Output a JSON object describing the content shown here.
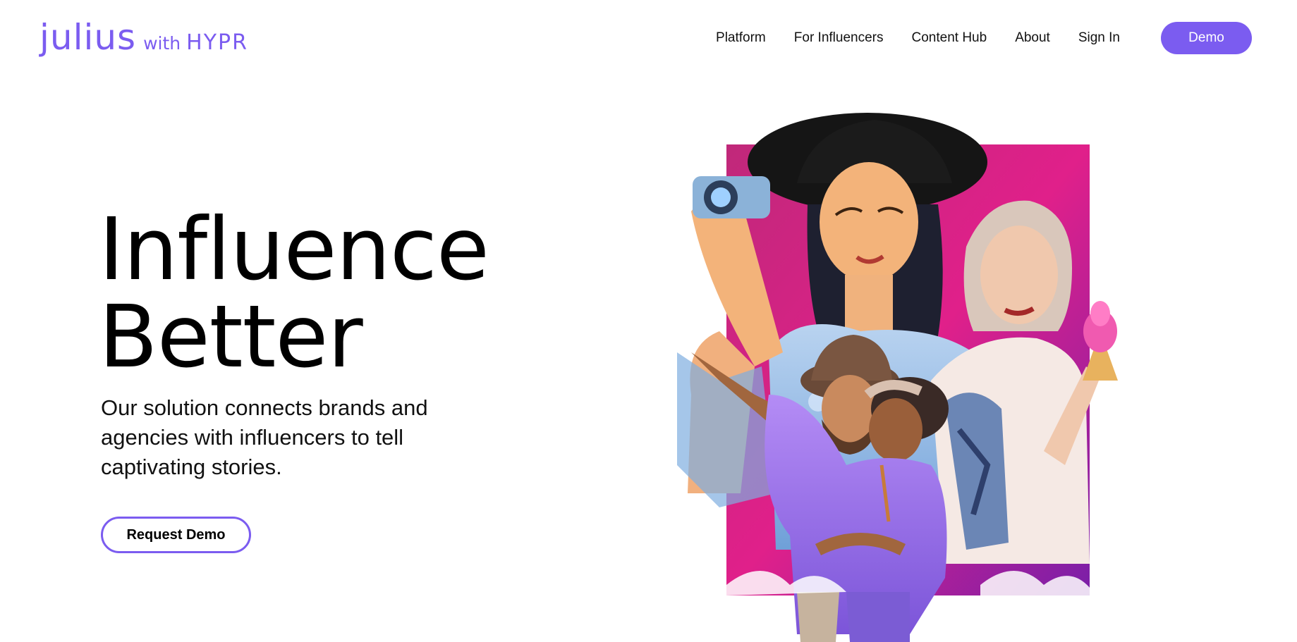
{
  "header": {
    "logo": {
      "main": "julius",
      "with": "with",
      "brand": "HYPR"
    },
    "nav": [
      {
        "label": "Platform"
      },
      {
        "label": "For Influencers"
      },
      {
        "label": "Content Hub"
      },
      {
        "label": "About"
      },
      {
        "label": "Sign In"
      }
    ],
    "demo_label": "Demo"
  },
  "hero": {
    "title_line1": "Influence",
    "title_line2": "Better",
    "subtitle": "Our solution connects brands and agencies with influencers to tell captivating stories.",
    "cta_label": "Request Demo"
  },
  "colors": {
    "accent": "#7b5cf0",
    "text": "#111111",
    "magenta": "#e0208a",
    "purple": "#8a2be2"
  },
  "illustration": {
    "icon": "influencers-collage-image"
  }
}
